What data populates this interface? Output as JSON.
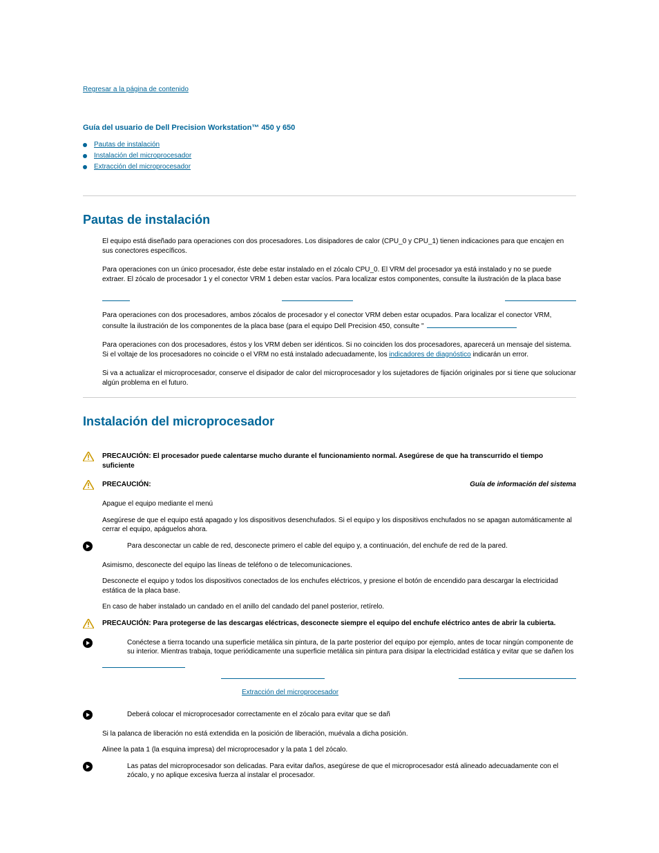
{
  "top_link": "Regresar a la página de contenido",
  "guide_title": "Guía del usuario de Dell Precision Workstation™ 450 y 650",
  "toc": {
    "items": [
      {
        "label": "Pautas de instalación"
      },
      {
        "label": "Instalación del microprocesador"
      },
      {
        "label": "Extracción del microprocesador"
      }
    ]
  },
  "section1": {
    "title": "Pautas de instalación",
    "p1": "El equipo está diseñado para operaciones con dos procesadores. Los disipadores de calor (CPU_0 y CPU_1) tienen indicaciones para que encajen en sus conectores específicos.",
    "p2": "Para operaciones con un único procesador, éste debe estar instalado en el zócalo CPU_0. El VRM del procesador ya está instalado y no se puede extraer. El zócalo de procesador 1 y el conector VRM 1 deben estar vacíos. Para localizar estos componentes, consulte la ilustración de la placa base",
    "p3": "Para operaciones con dos procesadores, ambos zócalos de procesador y el conector VRM deben estar ocupados. Para localizar el conector VRM, consulte la ilustración de los componentes de la placa base (para el equipo Dell Precision 450, consulte \"",
    "p4a": "Para operaciones con dos procesadores, éstos y los VRM deben ser idénticos. Si no coinciden los dos procesadores, aparecerá un mensaje del sistema. Si el voltaje de los procesadores no coincide o el VRM no está instalado adecuadamente, los ",
    "p4_link": "indicadores de diagnóstico",
    "p4b": " indicarán un error.",
    "p5": "Si va a actualizar el microprocesador, conserve el disipador de calor del microprocesador y los sujetadores de fijación originales por si tiene que solucionar algún problema en el futuro."
  },
  "section2": {
    "title": "Instalación del microprocesador",
    "caution1": "PRECAUCIÓN: El procesador puede calentarse mucho durante el funcionamiento normal. Asegúrese de que ha transcurrido el tiempo suficiente",
    "caution2_label": "PRECAUCIÓN:",
    "caution2_right": "Guía de información del sistema",
    "step1": "Apague el equipo mediante el menú",
    "step2": "Asegúrese de que el equipo está apagado y los dispositivos desenchufados. Si el equipo y los dispositivos enchufados no se apagan automáticamente al cerrar el equipo, apáguelos ahora.",
    "aviso1": "Para desconectar un cable de red, desconecte primero el cable del equipo y, a continuación, del enchufe de red de la pared.",
    "step3": "Asimismo, desconecte del equipo las líneas de teléfono o de telecomunicaciones.",
    "step4": "Desconecte el equipo y todos los dispositivos conectados de los enchufes eléctricos, y presione el botón de encendido para descargar la electricidad estática de la placa base.",
    "step5": "En caso de haber instalado un candado en el anillo del candado del panel posterior, retírelo.",
    "caution3": "PRECAUCIÓN: Para protegerse de las descargas eléctricas, desconecte siempre el equipo del enchufe eléctrico antes de abrir la cubierta.",
    "aviso2": "Conéctese a tierra tocando una superficie metálica sin pintura, de la parte posterior del equipo por ejemplo, antes de tocar ningún componente de su interior. Mientras trabaja, toque periódicamente una superficie metálica sin pintura para disipar la electricidad estática y evitar que se dañen los",
    "extraction_link": "Extracción del microprocesador",
    "aviso3": "Deberá colocar el microprocesador correctamente en el zócalo para evitar que se dañ",
    "step6": "Si la palanca de liberación no está extendida en la posición de liberación, muévala a dicha posición.",
    "step7": "Alinee la pata 1 (la esquina impresa) del microprocesador y la pata 1 del zócalo.",
    "aviso4": "Las patas del microprocesador son delicadas. Para evitar daños, asegúrese de que el microprocesador está alineado adecuadamente con el zócalo, y no aplique excesiva fuerza al instalar el procesador."
  }
}
